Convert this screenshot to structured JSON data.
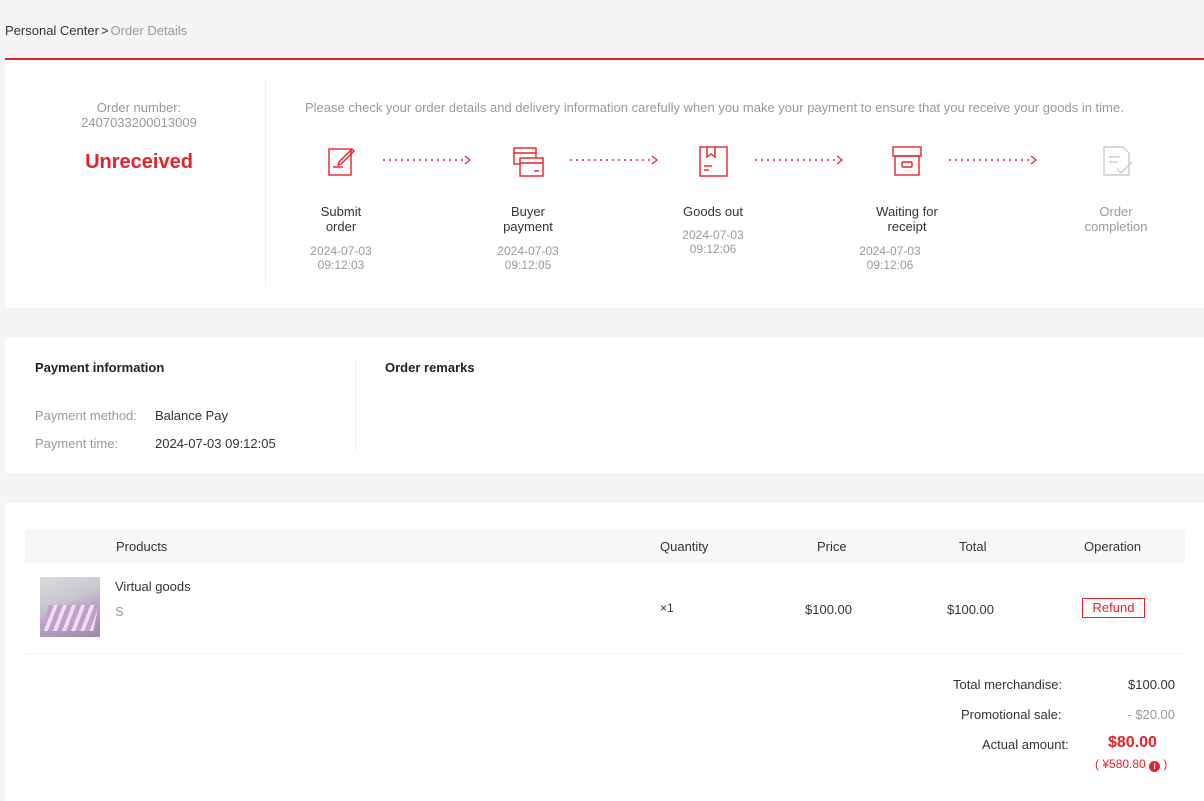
{
  "breadcrumb": {
    "root": "Personal Center",
    "sep": ">",
    "current": "Order Details"
  },
  "order": {
    "number_label": "Order number:",
    "number": "2407033200013009",
    "status": "Unreceived",
    "notice": "Please check your order details and delivery information carefully when you make your payment to ensure that you receive your goods in time."
  },
  "steps": [
    {
      "name": "Submit order",
      "date": "2024-07-03",
      "time": "09:12:03",
      "icon": "submit-order-icon"
    },
    {
      "name": "Buyer payment",
      "date": "2024-07-03",
      "time": "09:12:05",
      "icon": "payment-card-icon"
    },
    {
      "name": "Goods out",
      "date": "2024-07-03",
      "time": "09:12:06",
      "icon": "package-icon"
    },
    {
      "name": "Waiting for receipt",
      "date": "2024-07-03",
      "time": "09:12:06",
      "icon": "box-icon"
    },
    {
      "name": "Order completion",
      "date": "",
      "time": "",
      "icon": "document-check-icon"
    }
  ],
  "payment": {
    "title": "Payment information",
    "method_label": "Payment method:",
    "method": "Balance Pay",
    "time_label": "Payment time:",
    "time": "2024-07-03 09:12:05"
  },
  "remarks": {
    "title": "Order remarks"
  },
  "table": {
    "headers": {
      "products": "Products",
      "quantity": "Quantity",
      "price": "Price",
      "total": "Total",
      "operation": "Operation"
    },
    "rows": [
      {
        "name": "Virtual goods",
        "sku": "S",
        "quantity": "×1",
        "price": "$100.00",
        "total": "$100.00",
        "action": "Refund"
      }
    ]
  },
  "summary": {
    "merch_label": "Total merchandise:",
    "merch": "$100.00",
    "promo_label": "Promotional sale:",
    "promo": "- $20.00",
    "actual_label": "Actual amount:",
    "actual": "$80.00",
    "converted_open": "(",
    "converted": "¥580.80",
    "converted_close": ")"
  },
  "colors": {
    "accent": "#e3222b",
    "muted": "#999999"
  }
}
